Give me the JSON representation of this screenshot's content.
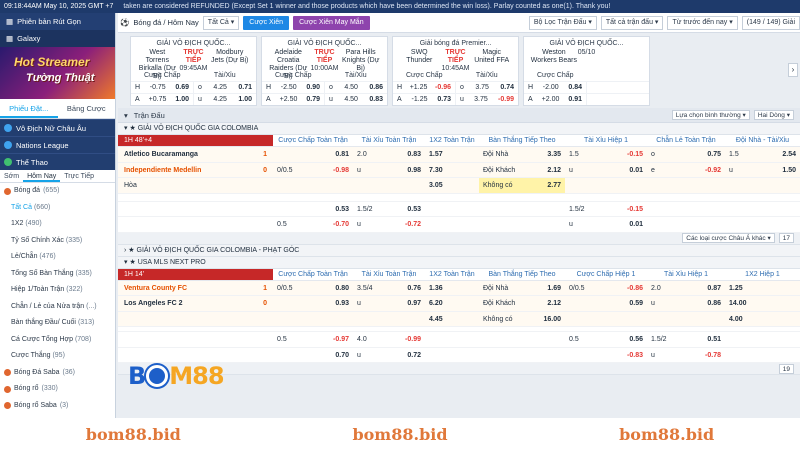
{
  "topbar": {
    "time": "09:18:44AM May 10, 2025 GMT +7",
    "notice": "taken are considered REFUNDED (Except Set 1 winner and those products which have been determined the win loss). Parlay counted as one(1). Thank you!"
  },
  "sidebar": {
    "header_items": [
      {
        "label": "Phiên bản Rút Gọn"
      },
      {
        "label": "Galaxy"
      }
    ],
    "banner": {
      "line1": "Hot Streamer",
      "line2": "Tường Thuật"
    },
    "tabs": [
      {
        "label": "Phiếu Đặt..."
      },
      {
        "label": "Bảng Cược"
      }
    ],
    "sections": [
      {
        "label": "Vô Địch Nữ Châu Âu"
      },
      {
        "label": "Nations League"
      },
      {
        "label": "Thể Thao"
      }
    ],
    "subtabs": [
      {
        "label": "Sớm"
      },
      {
        "label": "Hôm Nay"
      },
      {
        "label": "Trực Tiếp"
      }
    ],
    "items": [
      {
        "label": "Bóng đá",
        "count": "(655)",
        "type": "sport"
      },
      {
        "label": "Tất Cả",
        "count": "(660)",
        "type": "sel"
      },
      {
        "label": "1X2",
        "count": "(490)"
      },
      {
        "label": "Tỷ Số Chính Xác",
        "count": "(335)"
      },
      {
        "label": "Lẻ/Chẵn",
        "count": "(476)"
      },
      {
        "label": "Tổng Số Bàn Thắng",
        "count": "(335)"
      },
      {
        "label": "Hiệp 1/Toàn Trận",
        "count": "(322)"
      },
      {
        "label": "Chẵn / Lẻ của Nửa trận",
        "count": "(...)"
      },
      {
        "label": "Bàn thắng Đầu/ Cuối",
        "count": "(313)"
      },
      {
        "label": "Cá Cược Tổng Hợp",
        "count": "(708)"
      },
      {
        "label": "Cược Thắng",
        "count": "(95)"
      },
      {
        "label": "Bóng Đá Saba",
        "count": "(36)",
        "type": "sport"
      },
      {
        "label": "Bóng rổ",
        "count": "(330)",
        "type": "sport"
      },
      {
        "label": "Bóng rổ Saba",
        "count": "(3)",
        "type": "sport"
      }
    ]
  },
  "filterbar": {
    "sport": "Bóng đá / Hôm Nay",
    "all": "Tất Cả",
    "btn1": "Cược Xiên",
    "btn2": "Cược Xiên May Mắn",
    "f1": "Bộ Lọc Trận Đấu",
    "f2": "Tất cả trận đấu",
    "f3": "Từ trước đến nay",
    "count": "(149 / 149) Giải"
  },
  "cards": [
    {
      "league": "GIẢI VÔ ĐỊCH QUỐC...",
      "home": "West Torrens Birkalla (Dự Bị)",
      "away": "Modbury Jets (Dự Bị)",
      "status": "TRỰC TIẾP",
      "time": "09:45AM",
      "h1": "Cược Chấp",
      "h2": "Tài/Xỉu",
      "r1": [
        "H",
        "-0.75",
        "0.69",
        "o",
        "4.25",
        "0.71"
      ],
      "r2": [
        "A",
        "+0.75",
        "1.00",
        "u",
        "4.25",
        "1.00"
      ]
    },
    {
      "league": "GIẢI VÔ ĐỊCH QUỐC...",
      "home": "Adelaide Croatia Raiders (Dự Bị)",
      "away": "Para Hills Knights (Dự Bị)",
      "status": "TRỰC TIẾP",
      "time": "10:00AM",
      "h1": "Cược Chấp",
      "h2": "Tài/Xỉu",
      "r1": [
        "H",
        "-2.50",
        "0.90",
        "o",
        "4.50",
        "0.86"
      ],
      "r2": [
        "A",
        "+2.50",
        "0.79",
        "u",
        "4.50",
        "0.83"
      ]
    },
    {
      "league": "Giải bóng đá Premier...",
      "home": "SWQ Thunder",
      "away": "Magic United FFA",
      "status": "TRỰC TIẾP",
      "time": "10:45AM",
      "h1": "Cược Chấp",
      "h2": "Tài/Xỉu",
      "r1": [
        "H",
        "+1.25",
        "-0.96",
        "o",
        "3.75",
        "0.74"
      ],
      "r2": [
        "A",
        "-1.25",
        "0.73",
        "u",
        "3.75",
        "-0.99"
      ]
    },
    {
      "league": "GIẢI VÔ ĐỊCH QUỐC...",
      "home": "Weston Workers Bears",
      "away": "",
      "status": "",
      "time": "05/10",
      "h1": "Cược Chấp",
      "h2": "",
      "r1": [
        "H",
        "-2.00",
        "0.84",
        ""
      ],
      "r2": [
        "A",
        "+2.00",
        "0.91",
        ""
      ]
    }
  ],
  "section": {
    "title": "Trận Đấu",
    "sort": "Lựa chọn bình thường",
    "view": "Hai Dòng"
  },
  "leagues": [
    {
      "name": "GIẢI VÔ ĐỊCH QUỐC GIA COLOMBIA"
    },
    {
      "name": "GIẢI VÔ ĐỊCH QUỐC GIA COLOMBIA - PHẠT GÓC"
    },
    {
      "name": "USA MLS NEXT PRO"
    }
  ],
  "match1": {
    "live": "1H 48'+4",
    "cols": [
      "Cược Chấp Toàn Trận",
      "Tài Xỉu Toàn Trận",
      "1X2 Toàn Trận",
      "Bàn Thắng Tiếp Theo",
      "Tài Xỉu Hiệp 1",
      "Chẵn Lẻ Toàn Trận",
      "Đội Nhà - Tài/Xỉu"
    ],
    "home": "Atletico Bucaramanga",
    "home_score": "1",
    "away": "Independiente Medellin",
    "away_score": "0",
    "draw": "Hòa",
    "r1": [
      "",
      "0.81",
      "2.0",
      "0.83",
      "1.57",
      "Đội Nhà",
      "3.35",
      "1.5",
      "-0.15",
      "o",
      "0.75",
      "1.5",
      "2.54"
    ],
    "r2": [
      "0/0.5",
      "-0.98",
      "u",
      "0.98",
      "7.30",
      "Đội Khách",
      "2.12",
      "u",
      "0.01",
      "e",
      "-0.92",
      "u",
      "1.50"
    ],
    "r3": [
      "3.05",
      "Không có",
      "2.77"
    ],
    "r4": [
      "",
      "0.53",
      "1.5/2",
      "0.53",
      "",
      "",
      "",
      "1.5/2",
      "-0.15"
    ],
    "r5": [
      "0.5",
      "-0.70",
      "u",
      "-0.72",
      "",
      "",
      "",
      "u",
      "0.01"
    ]
  },
  "corner_bar": {
    "label": "Các loại cược Châu Á khác",
    "page": "17"
  },
  "match2": {
    "live": "1H 14'",
    "cols": [
      "Cược Chấp Toàn Trận",
      "Tài Xỉu Toàn Trận",
      "1X2 Toàn Trận",
      "Bàn Thắng Tiếp Theo",
      "Cược Chấp Hiệp 1",
      "Tài Xỉu Hiệp 1",
      "1X2 Hiệp 1"
    ],
    "home": "Ventura County FC",
    "home_score": "1",
    "away": "Los Angeles FC 2",
    "away_score": "0",
    "r1": [
      "0/0.5",
      "0.80",
      "3.5/4",
      "0.76",
      "1.36",
      "Đội Nhà",
      "1.69",
      "0/0.5",
      "-0.86",
      "2.0",
      "0.87",
      "1.25"
    ],
    "r2": [
      "",
      "0.93",
      "u",
      "0.97",
      "6.20",
      "Đội Khách",
      "2.12",
      "",
      "0.59",
      "u",
      "0.86",
      "14.00"
    ],
    "r3": [
      "4.45",
      "Không có",
      "16.00",
      "",
      "",
      "4.00"
    ],
    "r4": [
      "0.5",
      "-0.97",
      "4.0",
      "-0.99",
      "",
      "",
      "",
      "0.5",
      "0.56",
      "1.5/2",
      "0.51"
    ],
    "r5": [
      "",
      "0.70",
      "u",
      "0.72",
      "",
      "",
      "",
      "",
      "-0.83",
      "u",
      "-0.78"
    ]
  },
  "bottom_page": "19",
  "logo": {
    "left": "B",
    "ball": "O",
    "right": "M88"
  },
  "footer": [
    "bom88.bid",
    "bom88.bid",
    "bom88.bid"
  ]
}
